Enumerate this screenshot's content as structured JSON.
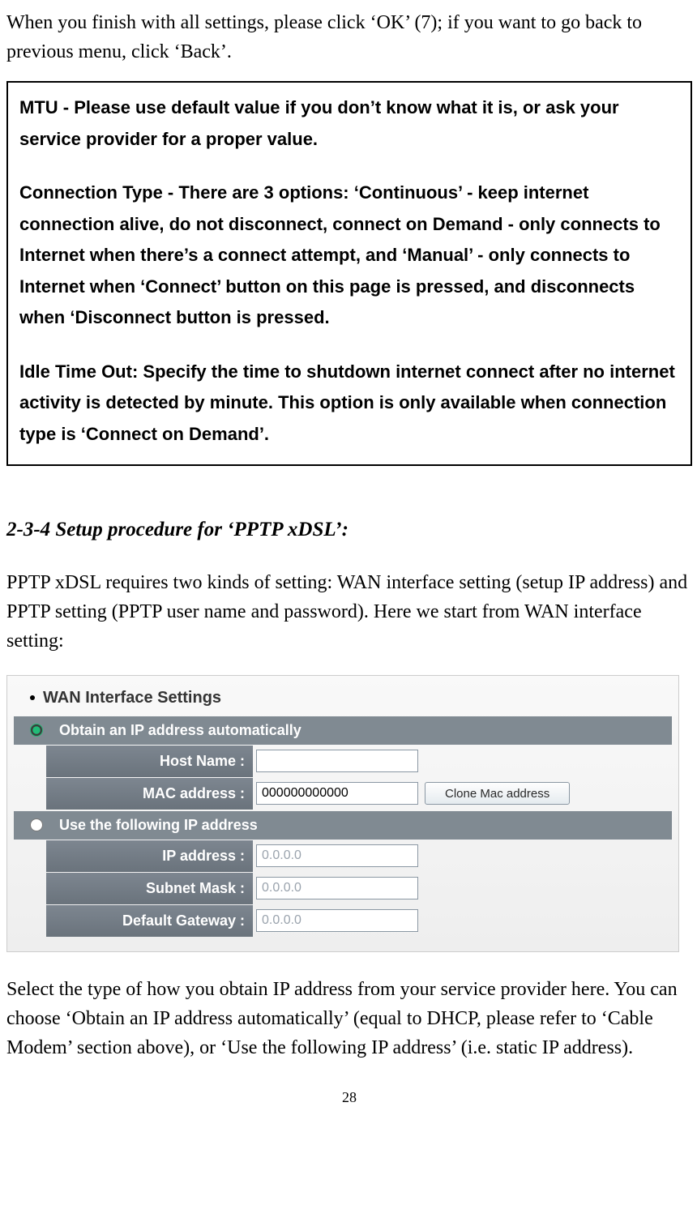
{
  "intro": "When you finish with all settings, please click ‘OK’ (7); if you want to go back to previous menu, click ‘Back’.",
  "infobox": {
    "p1": "MTU - Please use default value if you don’t know what it is, or ask your service provider for a proper value.",
    "p2": "Connection Type - There are 3 options: ‘Continuous’ - keep internet connection alive, do not disconnect, connect on Demand - only connects to Internet when there’s a connect attempt, and ‘Manual’ - only connects to Internet when ‘Connect’ button on this page is pressed, and disconnects when ‘Disconnect button is pressed.",
    "p3": "Idle Time Out: Specify the time to shutdown internet connect after no internet activity is detected by minute. This option is only available when connection type is ‘Connect on Demand’."
  },
  "section_heading": "2-3-4 Setup procedure for ‘PPTP xDSL’:",
  "section_intro": "PPTP xDSL requires two kinds of setting: WAN interface setting (setup IP address) and PPTP setting (PPTP user name and password). Here we start from WAN interface setting:",
  "panel": {
    "title": "WAN Interface Settings",
    "radio_auto_label": "Obtain an IP address automatically",
    "radio_static_label": "Use the following IP address",
    "hostname_label": "Host Name :",
    "hostname_value": "",
    "mac_label": "MAC address :",
    "mac_value": "000000000000",
    "clone_label": "Clone Mac address",
    "ip_label": "IP address :",
    "ip_value": "0.0.0.0",
    "subnet_label": "Subnet Mask :",
    "subnet_value": "0.0.0.0",
    "gateway_label": "Default Gateway :",
    "gateway_value": "0.0.0.0"
  },
  "outro": "Select the type of how you obtain IP address from your service provider here. You can choose ‘Obtain an IP address automatically’ (equal to DHCP, please refer to ‘Cable Modem’ section above), or ‘Use the following IP address’ (i.e. static IP address).",
  "page_number": "28"
}
